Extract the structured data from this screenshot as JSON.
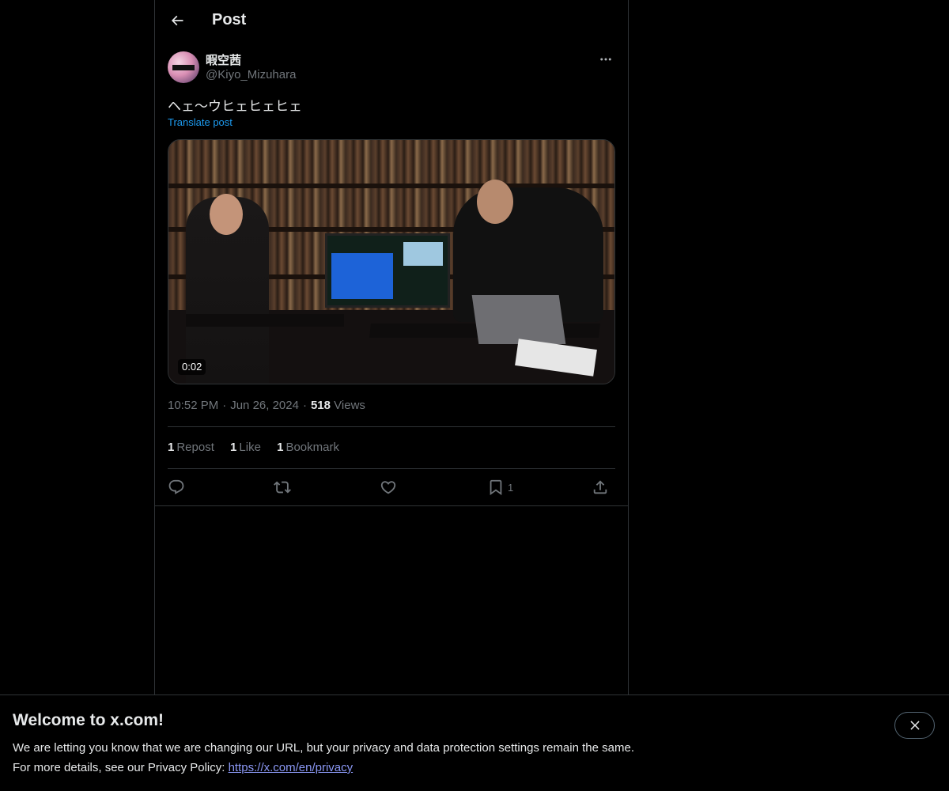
{
  "header": {
    "title": "Post",
    "back_icon": "arrow-left-icon"
  },
  "post": {
    "author": {
      "display_name": "暇空茜",
      "handle": "@Kiyo_Mizuhara"
    },
    "text": "ヘェ〜ウヒェヒェヒェ",
    "translate_label": "Translate post",
    "media": {
      "duration": "0:02"
    },
    "meta": {
      "time": "10:52 PM",
      "separator": "·",
      "date": "Jun 26, 2024",
      "views_count": "518",
      "views_label": "Views"
    },
    "stats": {
      "repost_count": "1",
      "repost_label": "Repost",
      "like_count": "1",
      "like_label": "Like",
      "bookmark_count": "1",
      "bookmark_label": "Bookmark"
    },
    "actions": {
      "reply_icon": "reply-icon",
      "repost_icon": "repost-icon",
      "like_icon": "heart-icon",
      "bookmark_icon": "bookmark-icon",
      "bookmark_count": "1",
      "share_icon": "share-icon"
    }
  },
  "banner": {
    "title": "Welcome to x.com!",
    "line1": "We are letting you know that we are changing our URL, but your privacy and data protection settings remain the same.",
    "line2_prefix": "For more details, see our Privacy Policy: ",
    "link_text": "https://x.com/en/privacy",
    "close_icon": "close-icon"
  },
  "colors": {
    "background": "#000000",
    "text": "#e7e9ea",
    "secondary_text": "#71767b",
    "accent": "#1d9bf0",
    "border": "#2f3336",
    "link": "#8b98f5"
  }
}
